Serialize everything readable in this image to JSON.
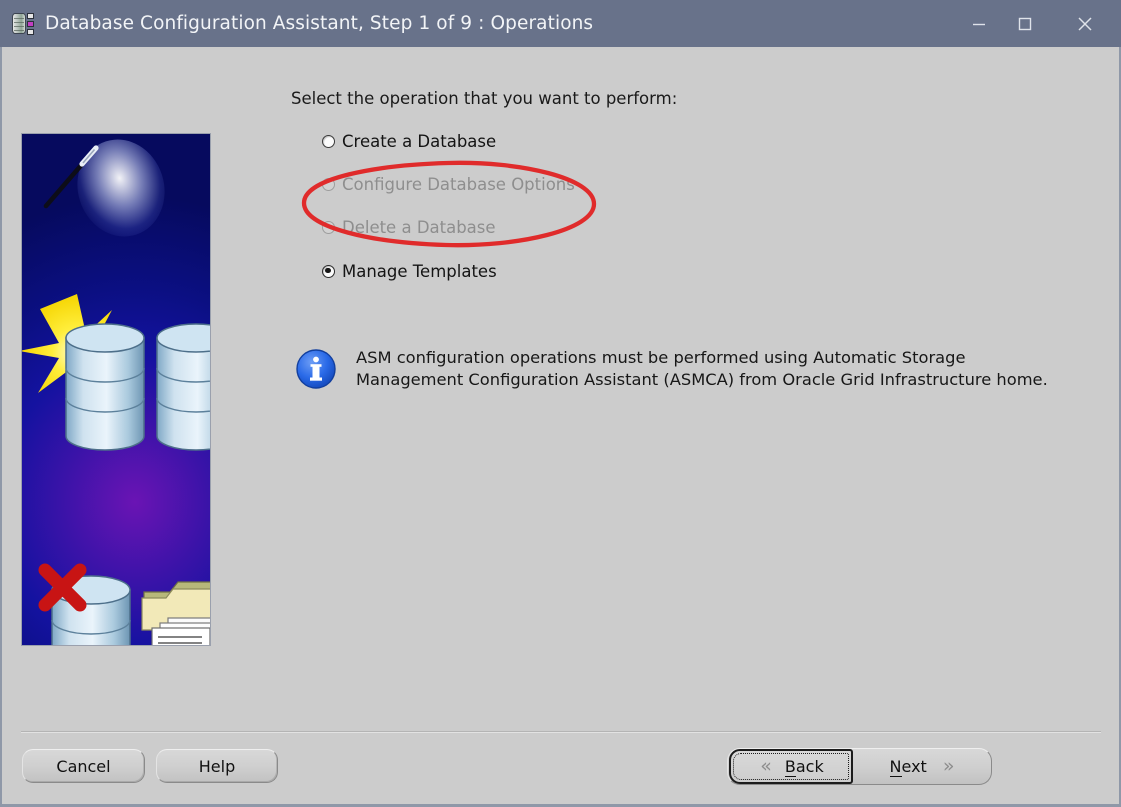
{
  "window": {
    "title": "Database Configuration Assistant, Step 1 of 9 : Operations",
    "icon": "database-config-icon",
    "controls": {
      "minimize": "minimize-icon",
      "maximize": "maximize-icon",
      "close": "close-icon"
    }
  },
  "colors": {
    "titlebar": "#68728a",
    "background": "#cccccc",
    "annotation": "#e02b2b",
    "info_icon": "#1e63e0",
    "disabled_text": "#8e8e8e"
  },
  "illustration": {
    "alt": "Oracle database wizard illustration with magic wand, sparkle, database cylinders, checkmarks, red X and document folders"
  },
  "main": {
    "prompt": "Select the operation that you want to perform:",
    "options": [
      {
        "label": "Create a Database",
        "selected": false,
        "disabled": false
      },
      {
        "label": "Configure Database Options",
        "selected": false,
        "disabled": true
      },
      {
        "label": "Delete a Database",
        "selected": false,
        "disabled": true
      },
      {
        "label": "Manage Templates",
        "selected": true,
        "disabled": false
      }
    ],
    "info": {
      "icon": "info-icon",
      "line1": "ASM configuration operations must be performed using Automatic Storage",
      "line2": "Management Configuration Assistant (ASMCA) from Oracle Grid Infrastructure home."
    }
  },
  "annotation": {
    "shape": "ellipse",
    "color": "#e02b2b",
    "encircles": [
      "Configure Database Options",
      "Delete a Database"
    ]
  },
  "footer": {
    "cancel": "Cancel",
    "help": "Help",
    "back": "Back",
    "back_mnemonic": "B",
    "next": "Next",
    "next_mnemonic": "N",
    "back_chevron": "«",
    "next_chevron": "»",
    "focused": "Back"
  }
}
